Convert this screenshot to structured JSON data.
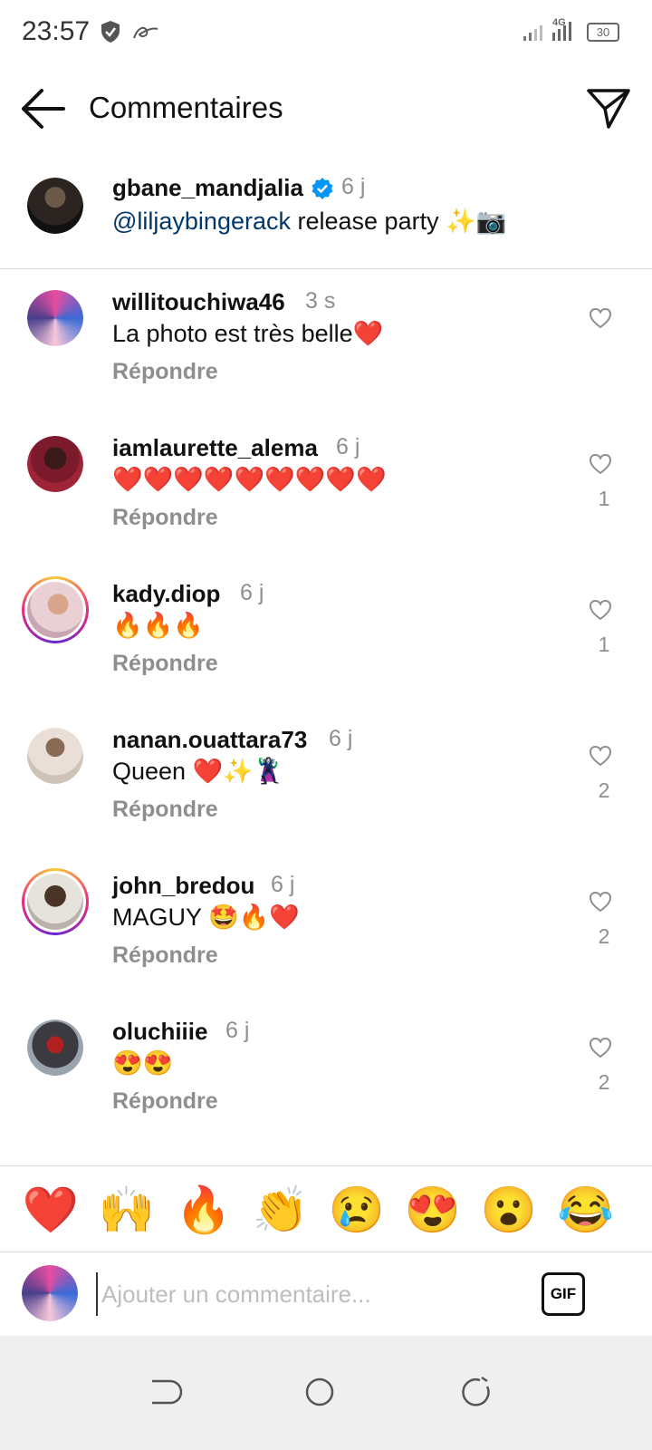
{
  "status_bar": {
    "time": "23:57",
    "network": "4G",
    "battery": "30",
    "icons": [
      "shield-icon",
      "app-notification-icon",
      "signal-icon",
      "battery-icon"
    ]
  },
  "header": {
    "title": "Commentaires",
    "back_icon": "arrow-left-icon",
    "share_icon": "paper-plane-icon"
  },
  "caption": {
    "username": "gbane_mandjalia",
    "verified": true,
    "time": "6 j",
    "mention": "@liljaybingerack",
    "text": " release party ✨📷"
  },
  "comments": [
    {
      "username": "willitouchiwa46",
      "time": "3 s",
      "text": "La photo est très belle❤️",
      "reply": "Répondre",
      "likes": ""
    },
    {
      "username": "iamlaurette_alema",
      "time": "6 j",
      "text": "❤️❤️❤️❤️❤️❤️❤️❤️❤️",
      "reply": "Répondre",
      "likes": "1"
    },
    {
      "username": "kady.diop",
      "time": "6 j",
      "text": "🔥🔥🔥",
      "reply": "Répondre",
      "likes": "1"
    },
    {
      "username": "nanan.ouattara73",
      "time": "6 j",
      "text": "Queen ❤️✨🦹‍♀️",
      "reply": "Répondre",
      "likes": "2"
    },
    {
      "username": "john_bredou",
      "time": "6 j",
      "text": "MAGUY 🤩🔥❤️",
      "reply": "Répondre",
      "likes": "2"
    },
    {
      "username": "oluchiiie",
      "time": "6 j",
      "text": "😍😍",
      "reply": "Répondre",
      "likes": "2"
    }
  ],
  "quick_reactions": [
    "❤️",
    "🙌",
    "🔥",
    "👏",
    "😢",
    "😍",
    "😮",
    "😂"
  ],
  "compose": {
    "placeholder": "Ajouter un commentaire...",
    "gif_label": "GIF"
  },
  "colors": {
    "mention": "#00376b",
    "secondary_text": "#8e8e8e",
    "verified": "#0095f6",
    "divider": "#dbdbdb"
  }
}
